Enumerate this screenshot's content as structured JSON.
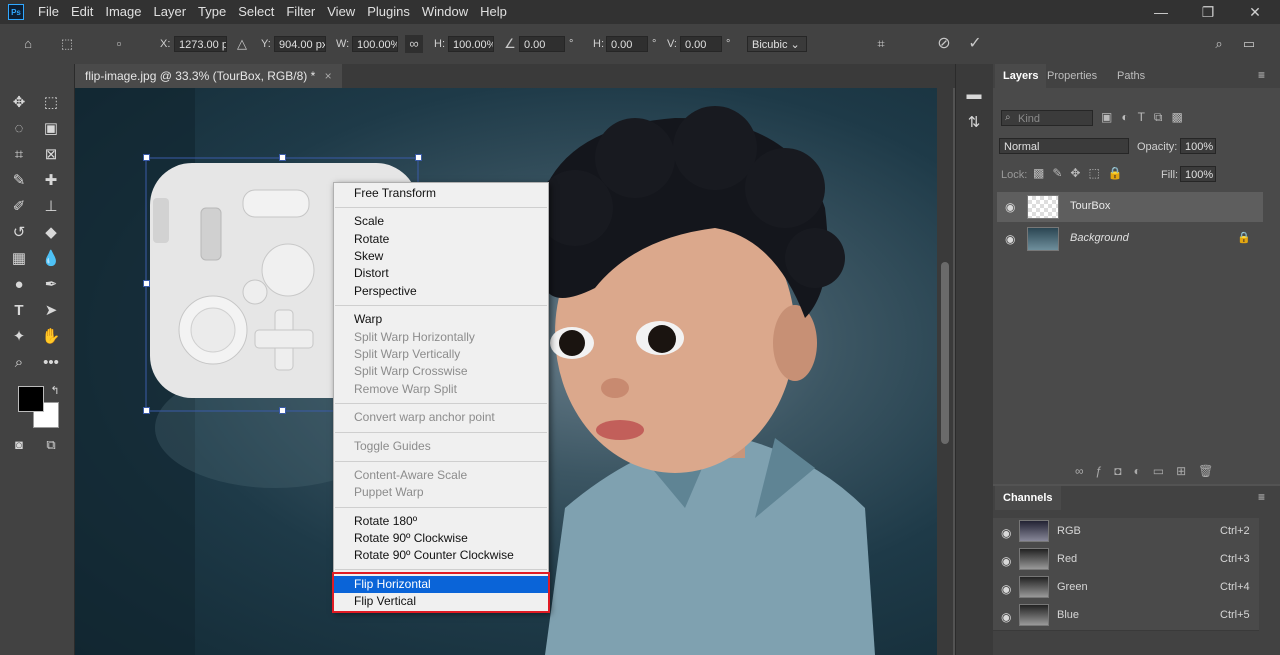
{
  "app": {
    "logo": "Ps"
  },
  "menubar": {
    "items": [
      "File",
      "Edit",
      "Image",
      "Layer",
      "Type",
      "Select",
      "Filter",
      "View",
      "Plugins",
      "Window",
      "Help"
    ]
  },
  "window_controls": {
    "minimize": "—",
    "restore": "❐",
    "close": "✕"
  },
  "options": {
    "x_label": "X:",
    "x_value": "1273.00 p",
    "y_label": "Y:",
    "y_value": "904.00 px",
    "w_label": "W:",
    "w_value": "100.00%",
    "h_label": "H:",
    "h_value": "100.00%",
    "angle_value": "0.00",
    "angle_unit": "°",
    "hskew_label": "H:",
    "hskew_value": "0.00",
    "hskew_unit": "°",
    "vskew_label": "V:",
    "vskew_value": "0.00",
    "vskew_unit": "°",
    "interpolation": "Bicubic"
  },
  "document_tab": {
    "title": "flip-image.jpg @ 33.3% (TourBox, RGB/8) *",
    "close": "×"
  },
  "context_menu": {
    "free_transform": "Free Transform",
    "scale": "Scale",
    "rotate": "Rotate",
    "skew": "Skew",
    "distort": "Distort",
    "perspective": "Perspective",
    "warp": "Warp",
    "split_h": "Split Warp Horizontally",
    "split_v": "Split Warp Vertically",
    "split_c": "Split Warp Crosswise",
    "remove_split": "Remove Warp Split",
    "convert_anchor": "Convert warp anchor point",
    "toggle_guides": "Toggle Guides",
    "content_aware": "Content-Aware Scale",
    "puppet": "Puppet Warp",
    "rotate180": "Rotate 180º",
    "rotate90cw": "Rotate 90º Clockwise",
    "rotate90ccw": "Rotate 90º Counter Clockwise",
    "flip_h": "Flip Horizontal",
    "flip_v": "Flip Vertical"
  },
  "layers_panel": {
    "tabs": [
      "Layers",
      "Properties",
      "Paths"
    ],
    "filter_placeholder": "Kind",
    "blend_mode": "Normal",
    "opacity_label": "Opacity:",
    "opacity_value": "100%",
    "lock_label": "Lock:",
    "fill_label": "Fill:",
    "fill_value": "100%",
    "layers": [
      {
        "name": "TourBox"
      },
      {
        "name": "Background"
      }
    ]
  },
  "channels_panel": {
    "tab": "Channels",
    "channels": [
      {
        "name": "RGB",
        "shortcut": "Ctrl+2"
      },
      {
        "name": "Red",
        "shortcut": "Ctrl+3"
      },
      {
        "name": "Green",
        "shortcut": "Ctrl+4"
      },
      {
        "name": "Blue",
        "shortcut": "Ctrl+5"
      }
    ]
  },
  "colors": {
    "accent": "#0a64d8",
    "highlight_box": "#e01b24",
    "selection_handle": "#3a5ba8"
  }
}
